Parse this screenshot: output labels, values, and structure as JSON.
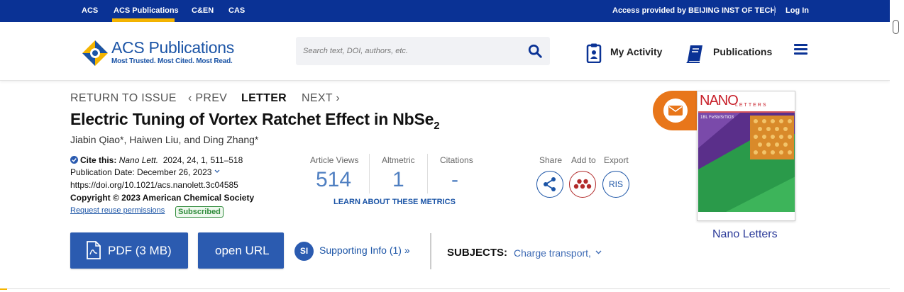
{
  "topbar": {
    "links": [
      "ACS",
      "ACS Publications",
      "C&EN",
      "CAS"
    ],
    "active": "ACS Publications",
    "access_text": "Access provided by BEIJING INST OF TECH",
    "login_label": "Log In"
  },
  "header": {
    "logo_title": "ACS Publications",
    "logo_tagline": "Most Trusted. Most Cited. Most Read.",
    "search_placeholder": "Search text, DOI, authors, etc.",
    "my_activity_label": "My Activity",
    "publications_label": "Publications"
  },
  "article_nav": {
    "return_label": "RETURN TO ISSUE",
    "prev_label": "‹ PREV",
    "type_label": "LETTER",
    "next_label": "NEXT ›"
  },
  "article": {
    "title_main": "Electric Tuning of Vortex Ratchet Effect in NbSe",
    "title_sub": "2",
    "authors": "Jiabin Qiao*, Haiwen Liu, and Ding Zhang*",
    "cite_label": "Cite this:",
    "cite_journal": "Nano Lett.",
    "cite_details": "2024, 24, 1, 511–518",
    "pub_date": "Publication Date: December 26, 2023",
    "doi": "https://doi.org/10.1021/acs.nanolett.3c04585",
    "copyright": "Copyright © 2023 American Chemical Society",
    "reuse_label": "Request reuse permissions",
    "access_badge": "Subscribed"
  },
  "metrics": {
    "views_label": "Article Views",
    "views_value": "514",
    "altmetric_label": "Altmetric",
    "altmetric_value": "1",
    "citations_label": "Citations",
    "citations_value": "-",
    "learn_label": "LEARN ABOUT THESE METRICS"
  },
  "actions": {
    "share_label": "Share",
    "addto_label": "Add to",
    "export_label": "Export",
    "ris_label": "RIS"
  },
  "buttons": {
    "pdf_label": "PDF (3 MB)",
    "openurl_label": "open URL",
    "si_badge": "SI",
    "si_label": "Supporting Info (1) »"
  },
  "subjects": {
    "label": "SUBJECTS:",
    "value": "Charge transport,"
  },
  "cover": {
    "journal_name": "Nano Letters",
    "cover_title": "NANO",
    "cover_subtitle": "LETTERS",
    "cover_caption": "1BL FeSb/SrTiO3"
  },
  "colors": {
    "brand_blue": "#0a3295",
    "accent_yellow": "#f4b400",
    "button_blue": "#2b5bb0",
    "email_orange": "#e8761a"
  }
}
